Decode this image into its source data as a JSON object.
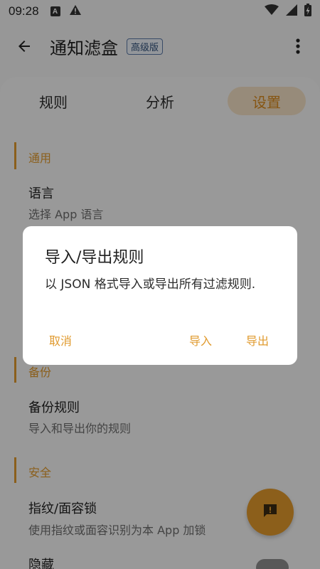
{
  "status_bar": {
    "time": "09:28",
    "a_icon_label": "A"
  },
  "app_bar": {
    "title": "通知滤盒",
    "badge": "高级版"
  },
  "tabs": {
    "rules": "规则",
    "analysis": "分析",
    "settings": "设置"
  },
  "settings": {
    "general": {
      "title": "通用",
      "language": {
        "title": "语言",
        "subtitle": "选择 App 语言"
      }
    },
    "backup": {
      "title": "备份",
      "backup_rules": {
        "title": "备份规则",
        "subtitle": "导入和导出你的规则"
      }
    },
    "security": {
      "title": "安全",
      "lock": {
        "title": "指纹/面容锁",
        "subtitle": "使用指纹或面容识别为本 App 加锁"
      },
      "hide": {
        "title": "隐藏"
      }
    }
  },
  "dialog": {
    "title": "导入/导出规则",
    "body": "以 JSON 格式导入或导出所有过滤规则.",
    "cancel": "取消",
    "import": "导入",
    "export": "导出"
  },
  "colors": {
    "accent": "#e09a2e",
    "tab_highlight": "#f4e0c6",
    "badge_border": "#5c7aa6"
  },
  "icons": {
    "back": "arrow-left-icon",
    "more": "more-vert-icon",
    "fab": "feedback-icon",
    "wifi": "wifi-icon",
    "signal": "signal-icon",
    "battery": "battery-charging-icon",
    "alert": "warning-icon"
  }
}
